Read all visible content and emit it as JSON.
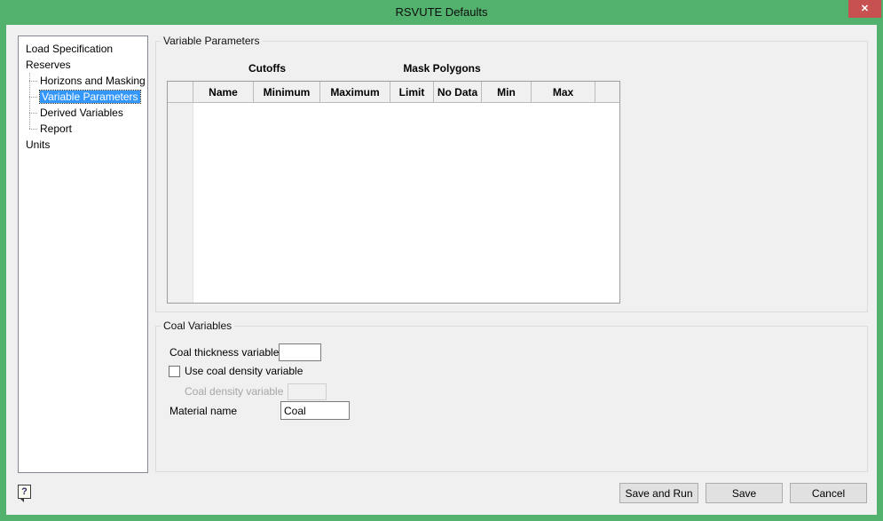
{
  "window": {
    "title": "RSVUTE Defaults"
  },
  "icons": {
    "close": "✕",
    "help": "?"
  },
  "colors": {
    "titlebar_green": "#53b16e",
    "close_red": "#c75050",
    "selection_blue": "#3296fb",
    "dialog_bg": "#f0f0f0"
  },
  "sidebar": {
    "items": [
      {
        "label": "Load Specification",
        "level": 0,
        "selected": false
      },
      {
        "label": "Reserves",
        "level": 0,
        "selected": false
      },
      {
        "label": "Horizons and Masking",
        "level": 1,
        "selected": false
      },
      {
        "label": "Variable Parameters",
        "level": 1,
        "selected": true
      },
      {
        "label": "Derived Variables",
        "level": 1,
        "selected": false
      },
      {
        "label": "Report",
        "level": 1,
        "selected": false
      },
      {
        "label": "Units",
        "level": 0,
        "selected": false
      }
    ]
  },
  "main": {
    "variable_parameters": {
      "title": "Variable Parameters",
      "column_groups": [
        "Cutoffs",
        "Mask Polygons"
      ],
      "columns": [
        "",
        "Name",
        "Minimum",
        "Maximum",
        "Limit",
        "No Data",
        "Min",
        "Max"
      ],
      "rows": []
    },
    "coal": {
      "title": "Coal Variables",
      "thickness_label": "Coal thickness variable",
      "thickness_value": "",
      "use_density_label": "Use coal density variable",
      "use_density_checked": false,
      "density_label": "Coal density variable",
      "density_value": "",
      "material_label": "Material name",
      "material_value": "Coal"
    }
  },
  "footer": {
    "buttons": [
      "Save and Run",
      "Save",
      "Cancel"
    ]
  }
}
